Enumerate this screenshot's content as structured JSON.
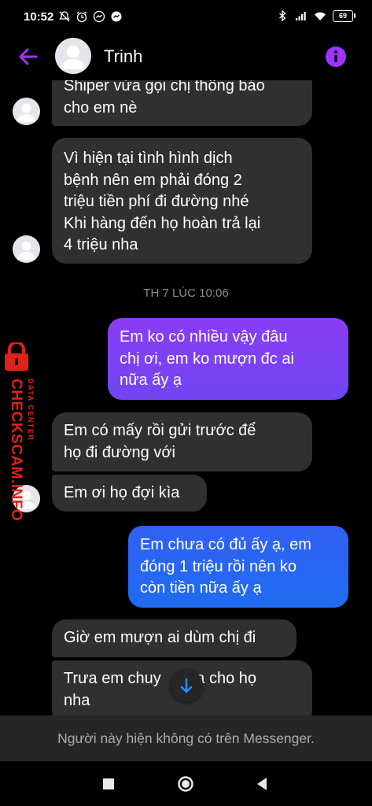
{
  "status_bar": {
    "time": "10:52",
    "battery": "69",
    "icons_left": [
      "mute-icon",
      "alarm-icon",
      "messenger-icon",
      "messenger-icon"
    ],
    "icons_right": [
      "bluetooth-icon",
      "signal-icon",
      "wifi-icon",
      "battery-icon"
    ]
  },
  "header": {
    "contact_name": "Trinh",
    "accent_color": "#a033ff"
  },
  "messages": [
    {
      "id": "m1",
      "dir": "in",
      "text": "Shiper vừa gọi chị thông báo\ncho em nè"
    },
    {
      "id": "m2",
      "dir": "in",
      "text": "Vì hiện tại tình hình dịch\nbệnh nên em phải đóng 2\ntriệu tiền phí đi đường nhé\nKhi hàng đến họ hoàn trả lại\n4 triệu nha"
    },
    {
      "id": "ts1",
      "dir": "timestamp",
      "text": "TH 7 LÚC 10:06"
    },
    {
      "id": "m3",
      "dir": "out",
      "text": "Em ko có nhiều vậy đâu\nchị ơi, em ko mượn đc ai\nnữa ấy ạ"
    },
    {
      "id": "m4",
      "dir": "in",
      "text": "Em có mấy rồi gửi trước để\nhọ đi đường với"
    },
    {
      "id": "m5",
      "dir": "in",
      "text": "Em ơi họ đợi kìa"
    },
    {
      "id": "m6",
      "dir": "out",
      "text": "Em chưa có đủ ấy ạ, em\nđóng 1 triệu rồi nên ko\ncòn tiền nữa ấy ạ"
    },
    {
      "id": "m7",
      "dir": "in",
      "text": "Giờ em mượn ai dùm chị đi"
    },
    {
      "id": "m8",
      "dir": "in",
      "text": "Trưa em chuy    qua cho họ\nnha"
    }
  ],
  "watermark": {
    "brand": "CHECKSCAM.INFO",
    "tagline": "DATA CENTER",
    "color": "#e0201b"
  },
  "footer": {
    "notice": "Người này hiện không có trên Messenger."
  },
  "colors": {
    "incoming_bubble": "#303030",
    "outgoing_gradient_top": "#8a3cf5",
    "outgoing_gradient_bottom": "#1e6cf0",
    "timestamp": "#8a8d91"
  }
}
